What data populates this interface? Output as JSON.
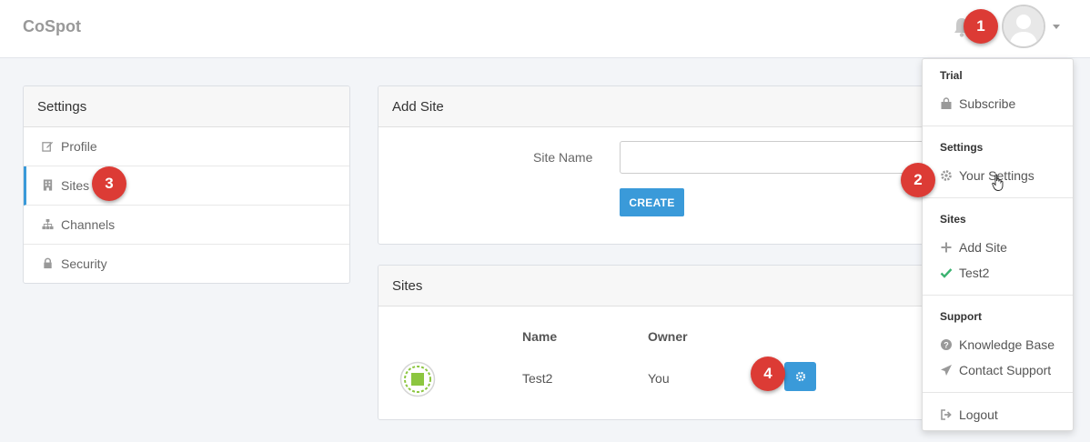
{
  "app": {
    "brand": "CoSpot"
  },
  "settings_panel": {
    "title": "Settings",
    "items": [
      {
        "label": "Profile",
        "icon": "edit-icon"
      },
      {
        "label": "Sites",
        "icon": "building-icon",
        "active": true
      },
      {
        "label": "Channels",
        "icon": "sitemap-icon"
      },
      {
        "label": "Security",
        "icon": "lock-icon"
      }
    ]
  },
  "add_site": {
    "title": "Add Site",
    "label": "Site Name",
    "value": "",
    "placeholder": "",
    "button": "CREATE"
  },
  "sites_panel": {
    "title": "Sites",
    "columns": [
      "Name",
      "Owner"
    ],
    "rows": [
      {
        "name": "Test2",
        "owner": "You"
      }
    ]
  },
  "dropdown": {
    "sections": [
      {
        "heading": "Trial",
        "items": [
          {
            "label": "Subscribe",
            "icon": "shopping-bag-icon"
          }
        ]
      },
      {
        "heading": "Settings",
        "items": [
          {
            "label": "Your Settings",
            "icon": "gear-icon"
          }
        ]
      },
      {
        "heading": "Sites",
        "items": [
          {
            "label": "Add Site",
            "icon": "plus-icon"
          },
          {
            "label": "Test2",
            "icon": "check-icon"
          }
        ]
      },
      {
        "heading": "Support",
        "items": [
          {
            "label": "Knowledge Base",
            "icon": "question-circle-icon"
          },
          {
            "label": "Contact Support",
            "icon": "paper-plane-icon"
          }
        ]
      }
    ],
    "logout": "Logout"
  },
  "callouts": [
    "1",
    "2",
    "3",
    "4"
  ],
  "colors": {
    "accent": "#3a9ad9",
    "callout": "#dc3b35",
    "check": "#3cb371"
  }
}
